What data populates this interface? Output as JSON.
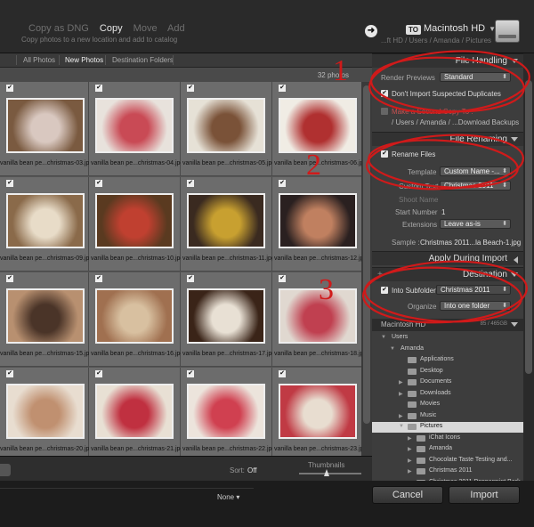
{
  "topbar": {
    "modes": [
      "Copy as DNG",
      "Copy",
      "Move",
      "Add"
    ],
    "active_mode": "Copy",
    "mode_description": "Copy photos to a new location and add to catalog",
    "to_badge": "TO",
    "destination_name": "Macintosh HD",
    "destination_path": "...ft HD / Users / Amanda / Pictures"
  },
  "grid": {
    "tabs": [
      "All Photos",
      "New Photos",
      "Destination Folders"
    ],
    "active_tab": "New Photos",
    "photo_count": "32 photos",
    "photos": [
      {
        "name": "vanilla bean pe...christmas-03.jpg",
        "c1": "#7a5a40",
        "c2": "#d9c8c0"
      },
      {
        "name": "vanilla bean pe...christmas-04.jpg",
        "c1": "#e8e2dc",
        "c2": "#c94a55"
      },
      {
        "name": "vanilla bean pe...christmas-05.jpg",
        "c1": "#e6e1d6",
        "c2": "#7a5238"
      },
      {
        "name": "vanilla bean pe...christmas-06.jpg",
        "c1": "#f0ece4",
        "c2": "#b03030"
      },
      {
        "name": "vanilla bean pe...christmas-09.jpg",
        "c1": "#8a6a4a",
        "c2": "#e8dcc8"
      },
      {
        "name": "vanilla bean pe...christmas-10.jpg",
        "c1": "#5a3a20",
        "c2": "#c04030"
      },
      {
        "name": "vanilla bean pe...christmas-11.jpg",
        "c1": "#3a2a20",
        "c2": "#c8a030"
      },
      {
        "name": "vanilla bean pe...christmas-12.jpg",
        "c1": "#2a2020",
        "c2": "#c08060"
      },
      {
        "name": "vanilla bean pe...christmas-15.jpg",
        "c1": "#b89070",
        "c2": "#4a3428"
      },
      {
        "name": "vanilla bean pe...christmas-16.jpg",
        "c1": "#a07050",
        "c2": "#d8c0a0"
      },
      {
        "name": "vanilla bean pe...christmas-17.jpg",
        "c1": "#3a2418",
        "c2": "#e8e0d4"
      },
      {
        "name": "vanilla bean pe...christmas-18.jpg",
        "c1": "#e0d8d0",
        "c2": "#c04050"
      },
      {
        "name": "vanilla bean pe...christmas-20.jpg",
        "c1": "#e8ddd0",
        "c2": "#c09070"
      },
      {
        "name": "vanilla bean pe...christmas-21.jpg",
        "c1": "#e8e0d4",
        "c2": "#c03040"
      },
      {
        "name": "vanilla bean pe...christmas-22.jpg",
        "c1": "#ece4dc",
        "c2": "#d04050"
      },
      {
        "name": "vanilla bean pe...christmas-23.jpg",
        "c1": "#c03a44",
        "c2": "#e8ddd0"
      }
    ],
    "sort_label": "Sort:",
    "sort_value": "Off",
    "thumbnails_label": "Thumbnails"
  },
  "footer": {
    "preset": "None",
    "cancel": "Cancel",
    "import": "Import"
  },
  "panel": {
    "file_handling": {
      "title": "File Handling",
      "render_previews_label": "Render Previews",
      "render_previews_value": "Standard",
      "dont_import_label": "Don't Import Suspected Duplicates",
      "second_copy_label": "Make a Second Copy To :",
      "second_copy_path": "/ Users / Amanda / ...Download Backups"
    },
    "file_renaming": {
      "title": "File Renaming",
      "rename_label": "Rename Files",
      "template_label": "Template",
      "template_value": "Custom Name -...",
      "custom_text_label": "Custom Text",
      "custom_text_value": "Christmas 2011",
      "shoot_name_label": "Shoot Name",
      "start_number_label": "Start Number",
      "start_number_value": "1",
      "extensions_label": "Extensions",
      "extensions_value": "Leave as-is",
      "sample_label": "Sample :",
      "sample_value": "Christmas 2011...la Beach-1.jpg"
    },
    "apply_during_import": {
      "title": "Apply During Import"
    },
    "destination": {
      "title": "Destination",
      "into_subfolder_label": "Into Subfolder",
      "into_subfolder_value": "Christmas 2011",
      "organize_label": "Organize",
      "organize_value": "Into one folder",
      "volume": "Macintosh HD",
      "volume_info": "85 / 465GB",
      "tree": [
        {
          "name": "Users",
          "level": 0,
          "expander": "▼",
          "folder": false
        },
        {
          "name": "Amanda",
          "level": 1,
          "expander": "▼",
          "folder": false
        },
        {
          "name": "Applications",
          "level": 2,
          "expander": "",
          "folder": true
        },
        {
          "name": "Desktop",
          "level": 2,
          "expander": "",
          "folder": true
        },
        {
          "name": "Documents",
          "level": 2,
          "expander": "▶",
          "folder": true
        },
        {
          "name": "Downloads",
          "level": 2,
          "expander": "▶",
          "folder": true
        },
        {
          "name": "Movies",
          "level": 2,
          "expander": "",
          "folder": true
        },
        {
          "name": "Music",
          "level": 2,
          "expander": "▶",
          "folder": true
        },
        {
          "name": "Pictures",
          "level": 2,
          "expander": "▼",
          "folder": true,
          "selected": true
        },
        {
          "name": "iChat Icons",
          "level": 3,
          "expander": "▶",
          "folder": true
        },
        {
          "name": "Amanda",
          "level": 3,
          "expander": "▶",
          "folder": true
        },
        {
          "name": "Chocolate Taste Testing and...",
          "level": 3,
          "expander": "▶",
          "folder": true
        },
        {
          "name": "Christmas 2011",
          "level": 3,
          "expander": "▶",
          "folder": true
        },
        {
          "name": "Christmas 2011 Peppermint Bark",
          "level": 3,
          "expander": "▶",
          "folder": true
        }
      ]
    }
  },
  "annotations": [
    "1",
    "2",
    "3"
  ],
  "colors": {
    "circle": "#d01a1a",
    "selected_row": "#d8d8d8"
  }
}
